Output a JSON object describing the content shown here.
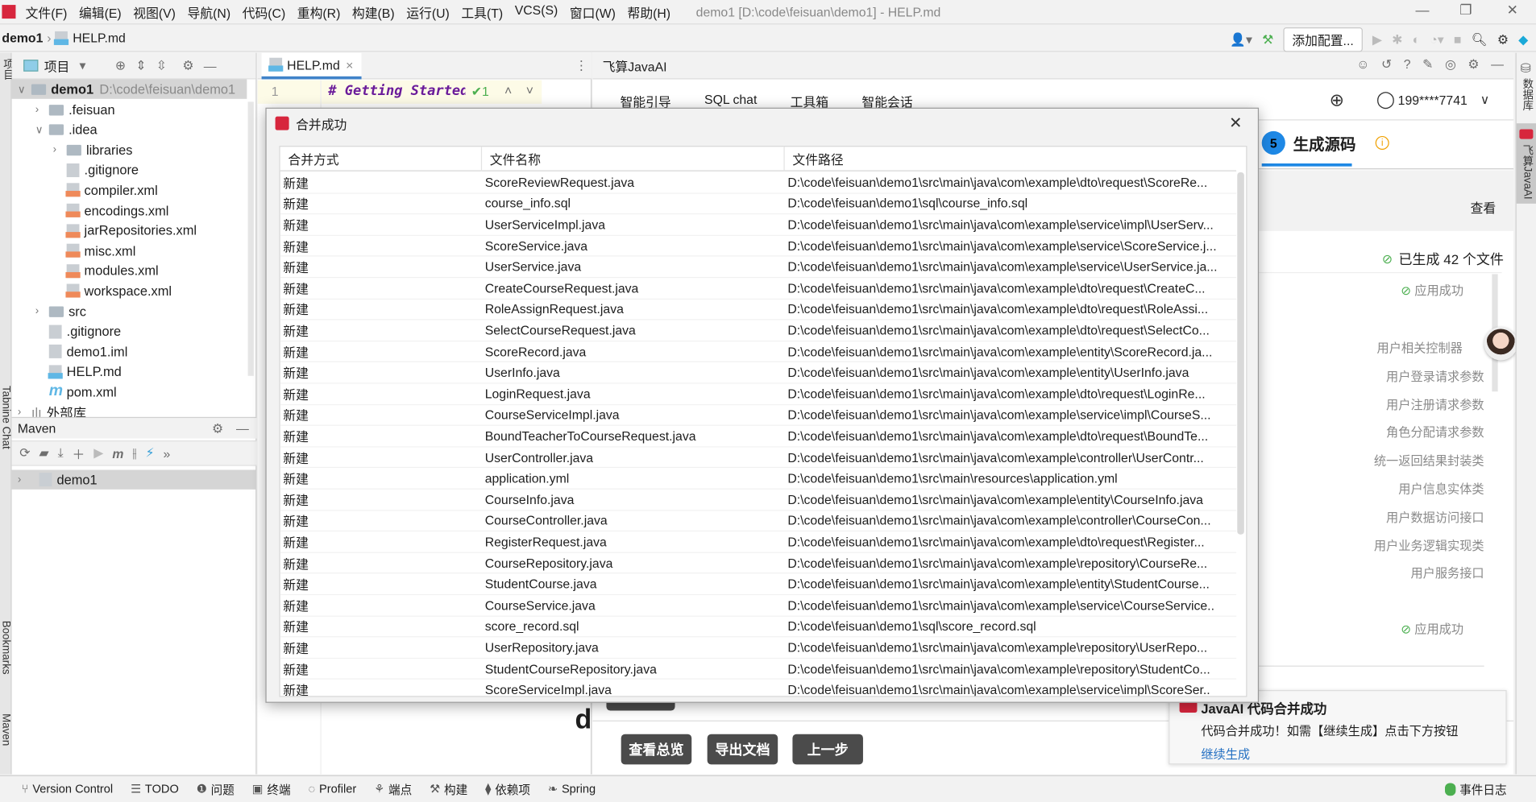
{
  "window": {
    "title": "demo1 [D:\\code\\feisuan\\demo1] - HELP.md"
  },
  "menu": [
    "文件(F)",
    "编辑(E)",
    "视图(V)",
    "导航(N)",
    "代码(C)",
    "重构(R)",
    "构建(B)",
    "运行(U)",
    "工具(T)",
    "VCS(S)",
    "窗口(W)",
    "帮助(H)"
  ],
  "navbar": {
    "project": "demo1",
    "file": "HELP.md",
    "add_config": "添加配置..."
  },
  "project_panel": {
    "title": "项目",
    "root": "demo1",
    "root_path": "D:\\code\\feisuan\\demo1",
    "items": [
      {
        "label": ".feisuan",
        "type": "folder",
        "depth": 1,
        "chevron": ">"
      },
      {
        "label": ".idea",
        "type": "folder",
        "depth": 1,
        "chevron": "v"
      },
      {
        "label": "libraries",
        "type": "folder",
        "depth": 2,
        "chevron": ">"
      },
      {
        "label": ".gitignore",
        "type": "file",
        "depth": 2
      },
      {
        "label": "compiler.xml",
        "type": "xml",
        "depth": 2
      },
      {
        "label": "encodings.xml",
        "type": "xml",
        "depth": 2
      },
      {
        "label": "jarRepositories.xml",
        "type": "xml",
        "depth": 2
      },
      {
        "label": "misc.xml",
        "type": "xml",
        "depth": 2
      },
      {
        "label": "modules.xml",
        "type": "xml",
        "depth": 2
      },
      {
        "label": "workspace.xml",
        "type": "xml",
        "depth": 2
      },
      {
        "label": "src",
        "type": "folder",
        "depth": 1,
        "chevron": ">"
      },
      {
        "label": ".gitignore",
        "type": "file",
        "depth": 1
      },
      {
        "label": "demo1.iml",
        "type": "file",
        "depth": 1
      },
      {
        "label": "HELP.md",
        "type": "md",
        "depth": 1
      },
      {
        "label": "pom.xml",
        "type": "maven",
        "depth": 1
      },
      {
        "label": "外部库",
        "type": "lib",
        "depth": 0,
        "chevron": ">"
      }
    ]
  },
  "maven": {
    "title": "Maven",
    "root": "demo1"
  },
  "editor": {
    "tab": "HELP.md",
    "line_no": "1",
    "code": "# Getting Started",
    "check_count": "1"
  },
  "javaai": {
    "title": "飞算JavaAI",
    "tabs": [
      "智能引导",
      "SQL chat",
      "工具箱",
      "智能会话"
    ],
    "user": "199****7741",
    "step_no": "5",
    "step_title": "生成源码",
    "view": "查看",
    "generated": "已生成 42 个文件",
    "applied": "应用成功",
    "applied2": "应用成功",
    "files_desc": [
      "用户相关控制器",
      "用户登录请求参数",
      "用户注册请求参数",
      "角色分配请求参数",
      "统一返回结果封装类",
      "用户信息实体类",
      "用户数据访问接口",
      "用户业务逻辑实现类",
      "用户服务接口"
    ],
    "buttons": [
      "查看总览",
      "导出文档",
      "上一步"
    ],
    "partial_letter": "d",
    "accent": "#1e88e5"
  },
  "notification": {
    "title": "JavaAI 代码合并成功",
    "body": "代码合并成功！如需【继续生成】点击下方按钮",
    "link": "继续生成"
  },
  "dialog": {
    "title": "合并成功",
    "columns": [
      "合并方式",
      "文件名称",
      "文件路径"
    ],
    "rows": [
      [
        "新建",
        "ScoreReviewRequest.java",
        "D:\\code\\feisuan\\demo1\\src\\main\\java\\com\\example\\dto\\request\\ScoreRe..."
      ],
      [
        "新建",
        "course_info.sql",
        "D:\\code\\feisuan\\demo1\\sql\\course_info.sql"
      ],
      [
        "新建",
        "UserServiceImpl.java",
        "D:\\code\\feisuan\\demo1\\src\\main\\java\\com\\example\\service\\impl\\UserServ..."
      ],
      [
        "新建",
        "ScoreService.java",
        "D:\\code\\feisuan\\demo1\\src\\main\\java\\com\\example\\service\\ScoreService.j..."
      ],
      [
        "新建",
        "UserService.java",
        "D:\\code\\feisuan\\demo1\\src\\main\\java\\com\\example\\service\\UserService.ja..."
      ],
      [
        "新建",
        "CreateCourseRequest.java",
        "D:\\code\\feisuan\\demo1\\src\\main\\java\\com\\example\\dto\\request\\CreateC..."
      ],
      [
        "新建",
        "RoleAssignRequest.java",
        "D:\\code\\feisuan\\demo1\\src\\main\\java\\com\\example\\dto\\request\\RoleAssi..."
      ],
      [
        "新建",
        "SelectCourseRequest.java",
        "D:\\code\\feisuan\\demo1\\src\\main\\java\\com\\example\\dto\\request\\SelectCo..."
      ],
      [
        "新建",
        "ScoreRecord.java",
        "D:\\code\\feisuan\\demo1\\src\\main\\java\\com\\example\\entity\\ScoreRecord.ja..."
      ],
      [
        "新建",
        "UserInfo.java",
        "D:\\code\\feisuan\\demo1\\src\\main\\java\\com\\example\\entity\\UserInfo.java"
      ],
      [
        "新建",
        "LoginRequest.java",
        "D:\\code\\feisuan\\demo1\\src\\main\\java\\com\\example\\dto\\request\\LoginRe..."
      ],
      [
        "新建",
        "CourseServiceImpl.java",
        "D:\\code\\feisuan\\demo1\\src\\main\\java\\com\\example\\service\\impl\\CourseS..."
      ],
      [
        "新建",
        "BoundTeacherToCourseRequest.java",
        "D:\\code\\feisuan\\demo1\\src\\main\\java\\com\\example\\dto\\request\\BoundTe..."
      ],
      [
        "新建",
        "UserController.java",
        "D:\\code\\feisuan\\demo1\\src\\main\\java\\com\\example\\controller\\UserContr..."
      ],
      [
        "新建",
        "application.yml",
        "D:\\code\\feisuan\\demo1\\src\\main\\resources\\application.yml"
      ],
      [
        "新建",
        "CourseInfo.java",
        "D:\\code\\feisuan\\demo1\\src\\main\\java\\com\\example\\entity\\CourseInfo.java"
      ],
      [
        "新建",
        "CourseController.java",
        "D:\\code\\feisuan\\demo1\\src\\main\\java\\com\\example\\controller\\CourseCon..."
      ],
      [
        "新建",
        "RegisterRequest.java",
        "D:\\code\\feisuan\\demo1\\src\\main\\java\\com\\example\\dto\\request\\Register..."
      ],
      [
        "新建",
        "CourseRepository.java",
        "D:\\code\\feisuan\\demo1\\src\\main\\java\\com\\example\\repository\\CourseRe..."
      ],
      [
        "新建",
        "StudentCourse.java",
        "D:\\code\\feisuan\\demo1\\src\\main\\java\\com\\example\\entity\\StudentCourse..."
      ],
      [
        "新建",
        "CourseService.java",
        "D:\\code\\feisuan\\demo1\\src\\main\\java\\com\\example\\service\\CourseService.."
      ],
      [
        "新建",
        "score_record.sql",
        "D:\\code\\feisuan\\demo1\\sql\\score_record.sql"
      ],
      [
        "新建",
        "UserRepository.java",
        "D:\\code\\feisuan\\demo1\\src\\main\\java\\com\\example\\repository\\UserRepo..."
      ],
      [
        "新建",
        "StudentCourseRepository.java",
        "D:\\code\\feisuan\\demo1\\src\\main\\java\\com\\example\\repository\\StudentCo..."
      ],
      [
        "新建",
        "ScoreServiceImpl.java",
        "D:\\code\\feisuan\\demo1\\src\\main\\java\\com\\example\\service\\impl\\ScoreSer.."
      ]
    ]
  },
  "statusbar": {
    "items": [
      "Version Control",
      "TODO",
      "问题",
      "终端",
      "Profiler",
      "端点",
      "构建",
      "依赖项",
      "Spring"
    ],
    "event_log": "事件日志"
  },
  "stripes": {
    "left": [
      "项目",
      "Tabnine Chat",
      "Bookmarks",
      "Maven"
    ],
    "right": [
      "数据库",
      "飞算JavaAI"
    ]
  }
}
